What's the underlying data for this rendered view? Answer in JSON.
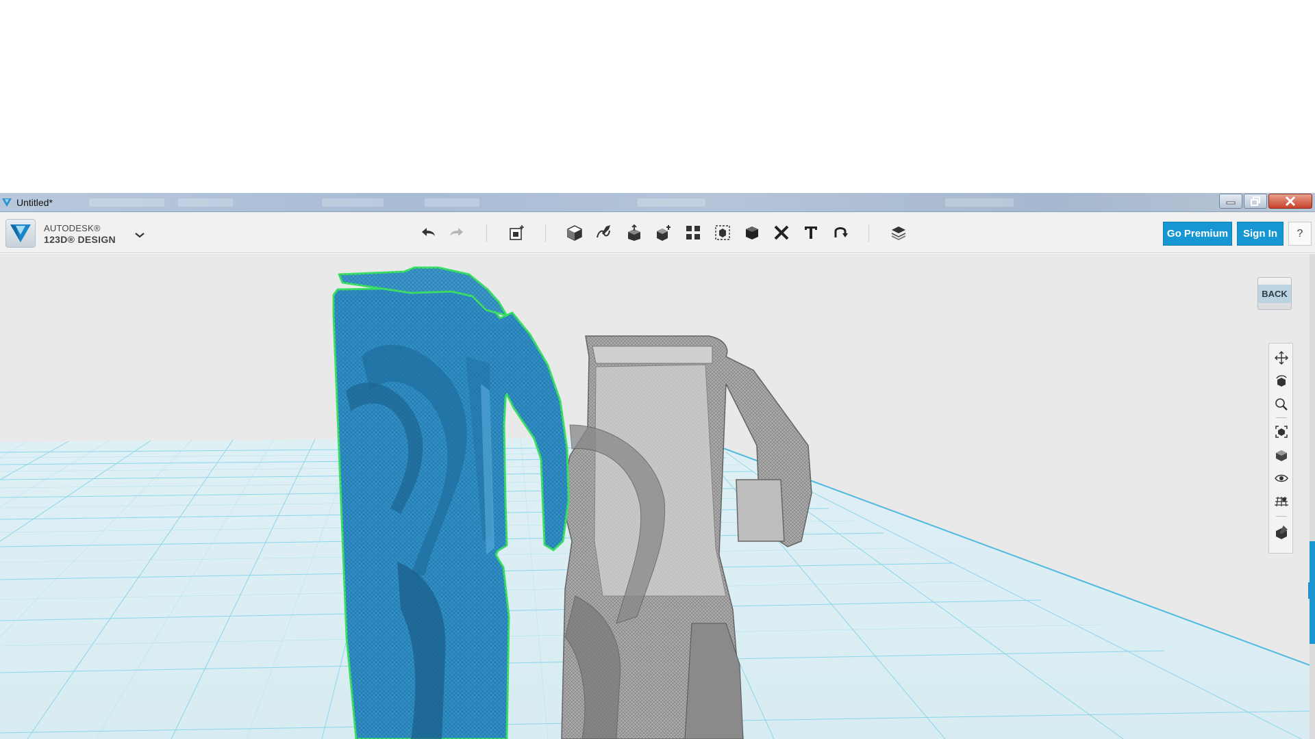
{
  "window": {
    "title": "Untitled*",
    "minimize": "minimize",
    "maximize": "maximize",
    "close": "close"
  },
  "brand": {
    "company": "AUTODESK®",
    "product": "123D® DESIGN"
  },
  "toolbar": {
    "tools": [
      "undo-icon",
      "redo-icon",
      "primitives-icon",
      "sketch-icon",
      "construct-icon",
      "modify-icon",
      "pattern-icon",
      "grouping-icon",
      "combine-icon",
      "measure-icon",
      "text-icon",
      "snap-icon",
      "material-icon"
    ]
  },
  "actions": {
    "premium_label": "Go Premium",
    "signin_label": "Sign In",
    "help_label": "?"
  },
  "viewcube": {
    "face_label": "BACK"
  },
  "navigation": {
    "items": [
      "pan-icon",
      "orbit-icon",
      "zoom-icon",
      "fit-icon",
      "view-icon",
      "visibility-icon",
      "grid-icon",
      "materials-icon"
    ]
  },
  "colors": {
    "accent": "#1696d3",
    "selected_part": "#2f8fc7",
    "selection_outline": "#3ce06a",
    "grid": "#5fc4e4",
    "ghost_part": "#9a9a9a"
  }
}
